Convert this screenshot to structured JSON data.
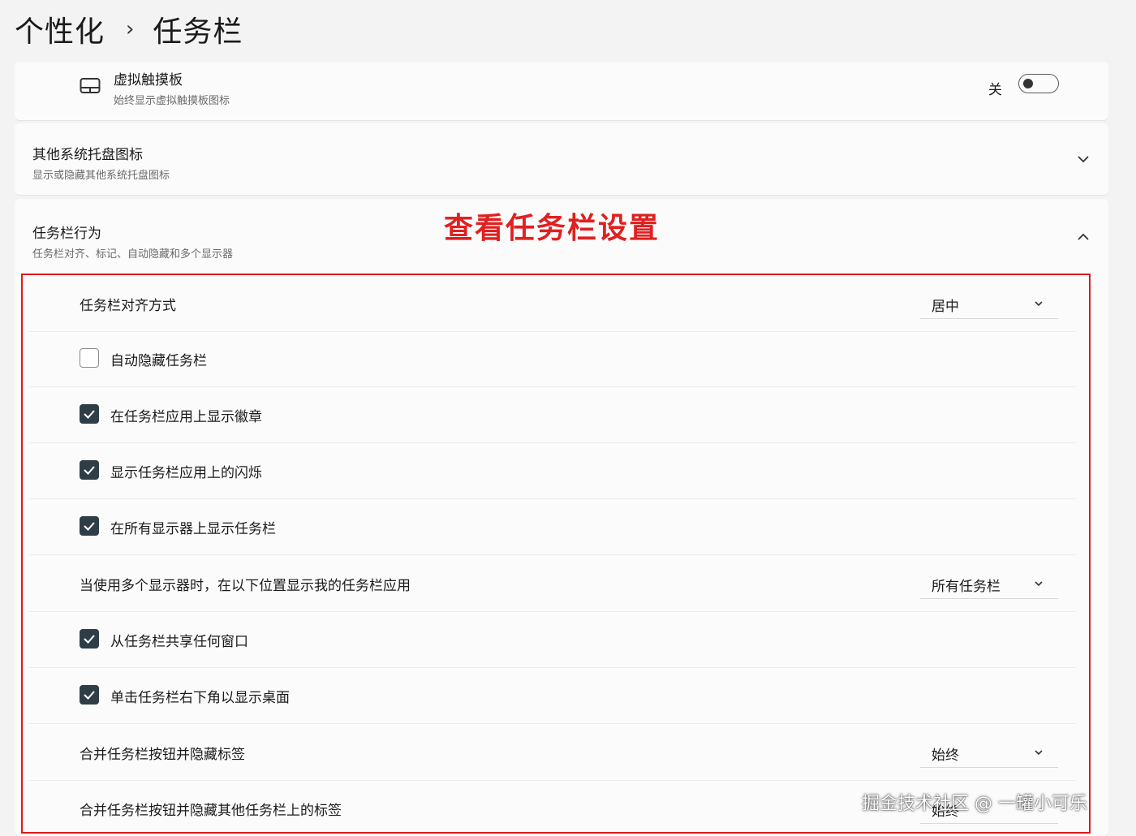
{
  "breadcrumb": {
    "parent": "个性化",
    "separator": "›",
    "current": "任务栏"
  },
  "touchpad": {
    "title": "虚拟触摸板",
    "subtitle": "始终显示虚拟触摸板图标",
    "toggle_label": "关",
    "toggle_on": false,
    "icon": "touchpad-icon"
  },
  "tray": {
    "title": "其他系统托盘图标",
    "subtitle": "显示或隐藏其他系统托盘图标",
    "expanded": false
  },
  "behavior": {
    "title": "任务栏行为",
    "subtitle": "任务栏对齐、标记、自动隐藏和多个显示器",
    "expanded": true,
    "rows": [
      {
        "type": "dropdown",
        "label": "任务栏对齐方式",
        "value": "居中"
      },
      {
        "type": "checkbox",
        "label": "自动隐藏任务栏",
        "checked": false
      },
      {
        "type": "checkbox",
        "label": "在任务栏应用上显示徽章",
        "checked": true
      },
      {
        "type": "checkbox",
        "label": "显示任务栏应用上的闪烁",
        "checked": true
      },
      {
        "type": "checkbox",
        "label": "在所有显示器上显示任务栏",
        "checked": true
      },
      {
        "type": "dropdown",
        "label": "当使用多个显示器时，在以下位置显示我的任务栏应用",
        "value": "所有任务栏"
      },
      {
        "type": "checkbox",
        "label": "从任务栏共享任何窗口",
        "checked": true
      },
      {
        "type": "checkbox",
        "label": "单击任务栏右下角以显示桌面",
        "checked": true
      },
      {
        "type": "dropdown",
        "label": "合并任务栏按钮并隐藏标签",
        "value": "始终"
      },
      {
        "type": "dropdown",
        "label": "合并任务栏按钮并隐藏其他任务栏上的标签",
        "value": "始终"
      }
    ]
  },
  "annotation": "查看任务栏设置",
  "annotation_color": "#e02020",
  "watermark": "掘金技术社区 @ 一罐小可乐"
}
